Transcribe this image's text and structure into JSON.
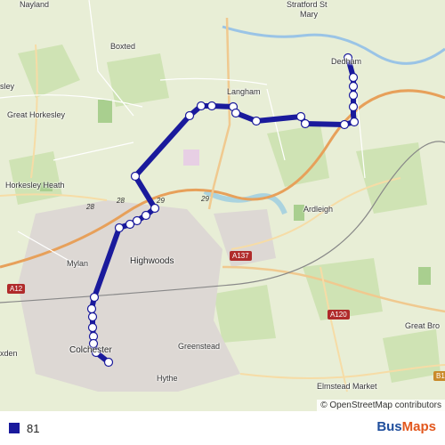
{
  "map": {
    "places": [
      {
        "name": "Nayland"
      },
      {
        "name": "Stratford St"
      },
      {
        "name": "Mary"
      },
      {
        "name": "Boxted"
      },
      {
        "name": "Dedham"
      },
      {
        "name": "sley"
      },
      {
        "name": "Langham"
      },
      {
        "name": "Great Horkesley"
      },
      {
        "name": "Horkesley Heath"
      },
      {
        "name": "Ardleigh"
      },
      {
        "name": "Mylan"
      },
      {
        "name": "Highwoods"
      },
      {
        "name": "Greenstead"
      },
      {
        "name": "Colchester"
      },
      {
        "name": "xden"
      },
      {
        "name": "Hythe"
      },
      {
        "name": "Elmstead Market"
      },
      {
        "name": "Great Bro"
      }
    ],
    "road_labels": [
      "A12",
      "A137",
      "A120",
      "B10"
    ],
    "junction_labels": [
      "28",
      "29",
      "28",
      "29"
    ],
    "attribution": "© OpenStreetMap contributors"
  },
  "route": {
    "name": "81",
    "color": "#1a1a9c"
  },
  "brand": {
    "part1": "Bus",
    "part2": "Maps"
  }
}
